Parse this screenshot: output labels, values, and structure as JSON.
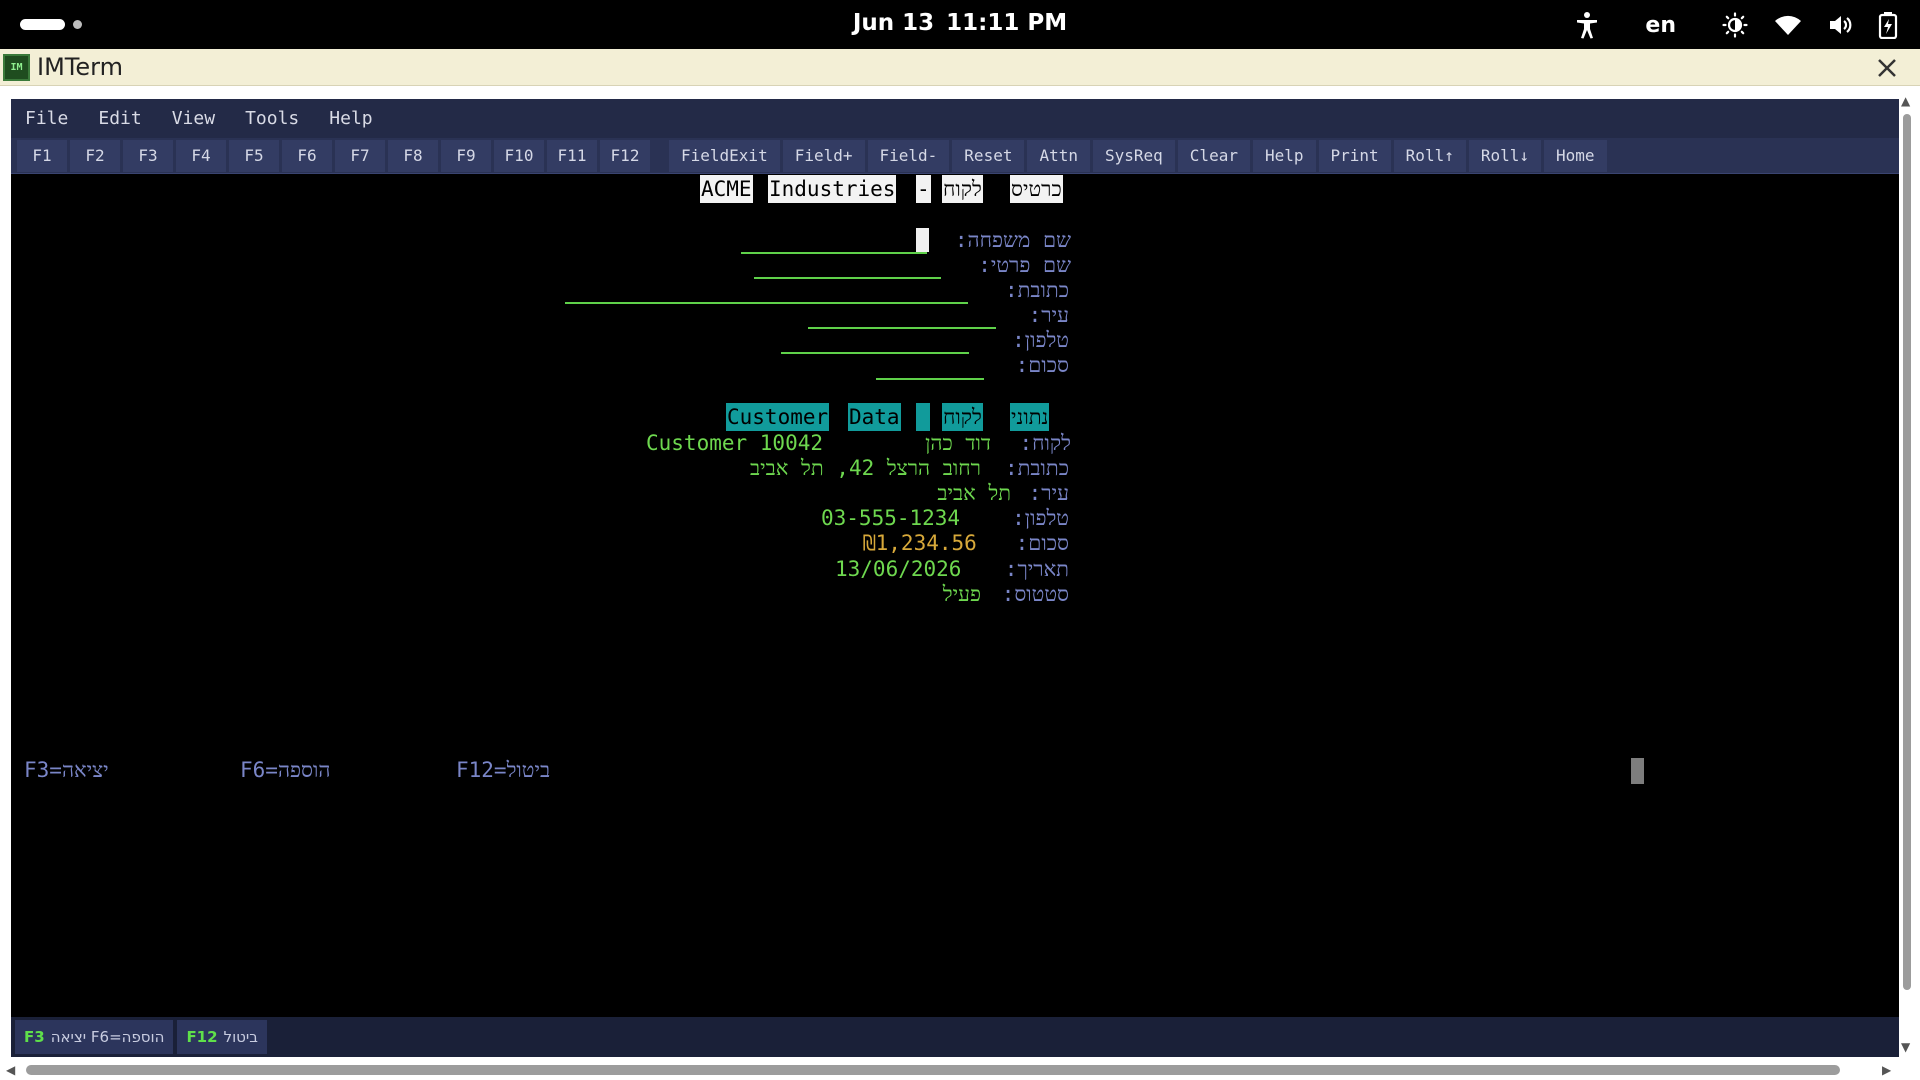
{
  "status_bar": {
    "date": "Jun 13",
    "time": "11:11 PM",
    "language": "en"
  },
  "app": {
    "title": "IMTerm",
    "icon_text": "IM"
  },
  "menu": [
    "File",
    "Edit",
    "View",
    "Tools",
    "Help"
  ],
  "toolbar": {
    "function_keys": [
      "F1",
      "F2",
      "F3",
      "F4",
      "F5",
      "F6",
      "F7",
      "F8",
      "F9",
      "F10",
      "F11",
      "F12"
    ],
    "actions": [
      "FieldExit",
      "Field+",
      "Field-",
      "Reset",
      "Attn",
      "SysReq",
      "Clear",
      "Help",
      "Print",
      "Roll↑",
      "Roll↓",
      "Home"
    ]
  },
  "screen": {
    "title_hebrew_1": "כרטיס",
    "title_hebrew_2": "לקוח",
    "title_dash": "-",
    "title_company_1": "ACME",
    "title_company_2": "Industries",
    "form": {
      "last_name_label": "שם משפחה:",
      "first_name_label": "שם פרטי:",
      "address_label": "כתובת:",
      "city_label": "עיר:",
      "phone_label": "טלפון:",
      "amount_label": "סכום:"
    },
    "data_header": {
      "hebrew_1": "נתוני",
      "hebrew_2": "לקוח",
      "english_1": "Data",
      "english_2": "Customer"
    },
    "data": {
      "customer_label": "לקוח:",
      "customer_name": "דוד כהן",
      "customer_id": "Customer 10042",
      "address_label": "כתובת:",
      "address_value": "רחוב הרצל 42, תל אביב",
      "city_label": "עיר:",
      "city_value": "תל אביב",
      "phone_label": "טלפון:",
      "phone_value": "03-555-1234",
      "amount_label": "סכום:",
      "amount_value": "₪1,234.56",
      "date_label": "תאריך:",
      "date_value": "13/06/2026",
      "status_label": "סטטוס:",
      "status_value": "פעיל"
    },
    "function_hints": [
      "F3=יציאה",
      "F6=הוספה",
      "F12=ביטול"
    ]
  },
  "key_bar": {
    "btn1_key": "F3",
    "btn1_text": "יציאה F6=הוספה",
    "btn2_key": "F12",
    "btn2_text": "ביטול"
  },
  "colors": {
    "terminal_bg": "#000000",
    "label_blue": "#7a86c8",
    "data_green": "#6ed84f",
    "amount_amber": "#d8a93a",
    "header_teal": "#119b9b",
    "menubar": "#232a47",
    "titlebar": "#f3efd6"
  }
}
